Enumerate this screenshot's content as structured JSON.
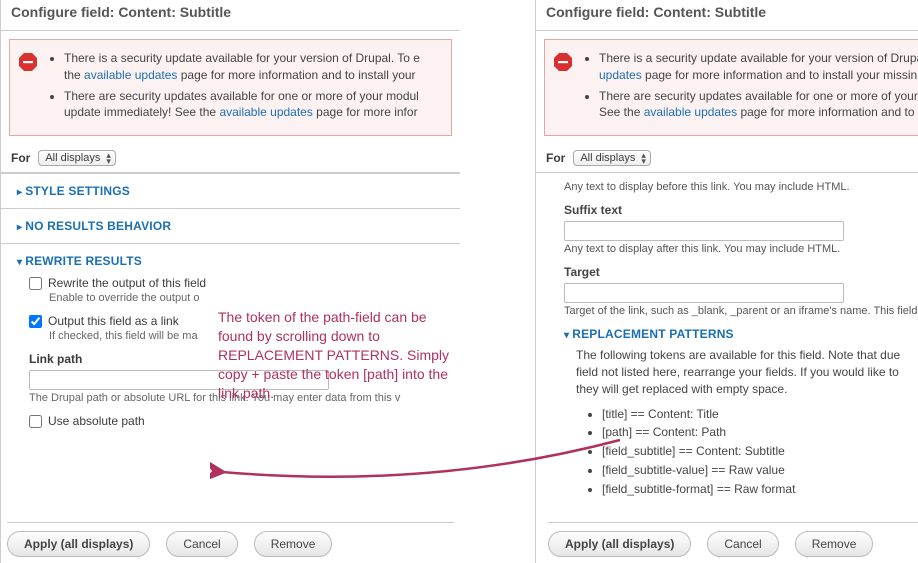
{
  "header_title": "Configure field: Content: Subtitle",
  "alert": {
    "line1_a": "There is a security update available for your version of Drupal. To e",
    "link1": "available updates",
    "line1_b": " page for more information and to install your",
    "line2_a": "There are security updates available for one or more of your modul",
    "line2_b": "update immediately! See the ",
    "link2": "available updates",
    "line2_c": " page for more infor",
    "r_line1_a": "There is a security update available for your version of Drupal.",
    "r_link1": "updates",
    "r_line1_b": " page for more information and to install your missin",
    "r_line2_a": "There are security updates available for one or more of your m",
    "r_line2_b": "See the ",
    "r_link2": "available updates",
    "r_line2_c": " page for more information and to in"
  },
  "for_label": "For",
  "for_value": "All displays",
  "sections": {
    "style": "STYLE SETTINGS",
    "noresults": "NO RESULTS BEHAVIOR",
    "rewrite": "REWRITE RESULTS",
    "replacement": "REPLACEMENT PATTERNS"
  },
  "rewrite": {
    "rewrite_output_label": "Rewrite the output of this field",
    "rewrite_output_help": "Enable to override the output o",
    "output_as_link_label": "Output this field as a link",
    "output_as_link_help": "If checked, this field will be ma",
    "link_path_label": "Link path",
    "link_path_help": "The Drupal path or absolute URL for this link. You may enter data from this v",
    "use_absolute_label": "Use absolute path"
  },
  "right_scroll": {
    "pre_help": "Any text to display before this link. You may include HTML.",
    "suffix_label": "Suffix text",
    "suffix_help": "Any text to display after this link. You may include HTML.",
    "target_label": "Target",
    "target_help": "Target of the link, such as _blank, _parent or an iframe's name. This field"
  },
  "replacement": {
    "intro": "The following tokens are available for this field. Note that due field not listed here, rearrange your fields. If you would like to they will get replaced with empty space.",
    "tokens": [
      "[title] == Content: Title",
      "[path] == Content: Path",
      "[field_subtitle] == Content: Subtitle",
      "[field_subtitle-value] == Raw value",
      "[field_subtitle-format] == Raw format"
    ]
  },
  "buttons": {
    "apply": "Apply (all displays)",
    "cancel": "Cancel",
    "remove": "Remove"
  },
  "annotation": "The token of the path-field can be found by scrolling down to REPLACEMENT PATTERNS. Simply copy + paste the token [path] into the link path."
}
